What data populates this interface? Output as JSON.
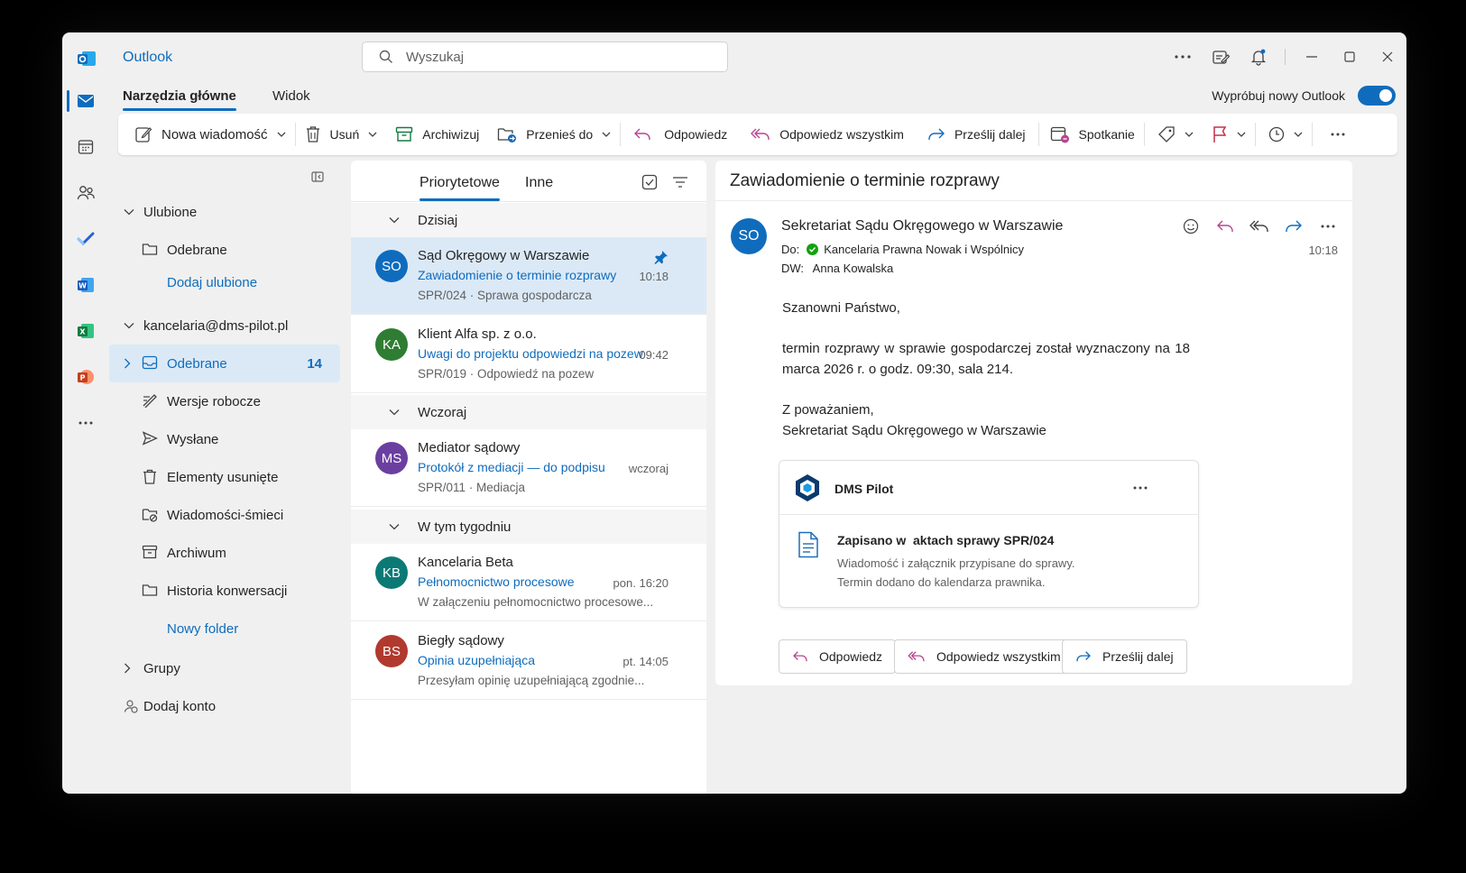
{
  "app": {
    "name": "Outlook"
  },
  "search": {
    "placeholder": "Wyszukaj"
  },
  "ribbon": {
    "tabs": [
      "Narzędzia główne",
      "Widok"
    ],
    "try_new": "Wypróbuj nowy Outlook",
    "toggle_on": true
  },
  "toolbar": {
    "new_message": "Nowa wiadomość",
    "delete": "Usuń",
    "archive": "Archiwizuj",
    "move_to": "Przenieś do",
    "reply": "Odpowiedz",
    "reply_all": "Odpowiedz wszystkim",
    "forward": "Prześlij dalej",
    "meeting": "Spotkanie"
  },
  "folders": {
    "favorites_header": "Ulubione",
    "favorites": [
      "Odebrane"
    ],
    "add_favorite": "Dodaj ulubione",
    "account": "kancelaria@dms-pilot.pl",
    "items": [
      {
        "label": "Odebrane",
        "count": "14",
        "icon": "inbox-icon"
      },
      {
        "label": "Wersje robocze",
        "icon": "draft-icon"
      },
      {
        "label": "Wysłane",
        "icon": "send-icon"
      },
      {
        "label": "Elementy usunięte",
        "icon": "trash-icon"
      },
      {
        "label": "Wiadomości-śmieci",
        "icon": "junk-icon"
      },
      {
        "label": "Archiwum",
        "icon": "archive-icon"
      },
      {
        "label": "Historia konwersacji",
        "icon": "folder-icon"
      }
    ],
    "new_folder": "Nowy folder",
    "groups": "Grupy",
    "add_account": "Dodaj konto"
  },
  "message_list": {
    "tabs": [
      "Priorytetowe",
      "Inne"
    ],
    "groups": [
      "Dzisiaj",
      "Wczoraj",
      "W tym tygodniu"
    ],
    "messages": [
      {
        "initials": "SO",
        "color": "#0f6cbd",
        "from": "Sąd Okręgowy w Warszawie",
        "subject": "Zawiadomienie o terminie rozprawy",
        "preview": "SPR/024 · Sprawa gospodarcza",
        "time": "10:18"
      },
      {
        "initials": "KA",
        "color": "#2e7d32",
        "from": "Klient Alfa sp. z o.o.",
        "subject": "Uwagi do projektu odpowiedzi na pozew",
        "preview": "SPR/019 · Odpowiedź na pozew",
        "time": "09:42"
      },
      {
        "initials": "MS",
        "color": "#6b3fa0",
        "from": "Mediator sądowy",
        "subject": "Protokół z mediacji — do podpisu",
        "preview": "SPR/011 · Mediacja",
        "time": "wczoraj"
      },
      {
        "initials": "KB",
        "color": "#0b7a75",
        "from": "Kancelaria Beta",
        "subject": "Pełnomocnictwo procesowe",
        "preview": "W załączeniu pełnomocnictwo procesowe...",
        "time": "pon. 16:20"
      },
      {
        "initials": "BS",
        "color": "#b03a2e",
        "from": "Biegły sądowy",
        "subject": "Opinia uzupełniająca",
        "preview": "Przesyłam opinię uzupełniającą zgodnie...",
        "time": "pt. 14:05"
      }
    ]
  },
  "reading": {
    "subject": "Zawiadomienie o terminie rozprawy",
    "sender_initials": "SO",
    "sender": "Sekretariat Sądu Okręgowego w Warszawie",
    "to_label": "Do:",
    "to": "Kancelaria Prawna Nowak i Wspólnicy",
    "cc_label": "DW:",
    "cc": "Anna Kowalska",
    "time": "10:18",
    "greeting": "Szanowni Państwo,",
    "body": "termin rozprawy w sprawie gospodarczej został wyznaczony na 18 marca 2026 r. o godz. 09:30, sala 214.",
    "closing": "Z poważaniem,",
    "signature": "Sekretariat Sądu Okręgowego w Warszawie",
    "addin": {
      "name": "DMS Pilot",
      "heading": "Zapisano w  aktach sprawy SPR/024",
      "line1": "Wiadomość i załącznik przypisane do sprawy.",
      "line2": "Termin dodano do kalendarza prawnika."
    },
    "buttons": {
      "reply": "Odpowiedz",
      "reply_all": "Odpowiedz wszystkim",
      "forward": "Prześlij dalej"
    }
  },
  "colors": {
    "accent": "#0f6cbd",
    "selection": "#dbe9f7",
    "background": "#f0f0f0"
  }
}
